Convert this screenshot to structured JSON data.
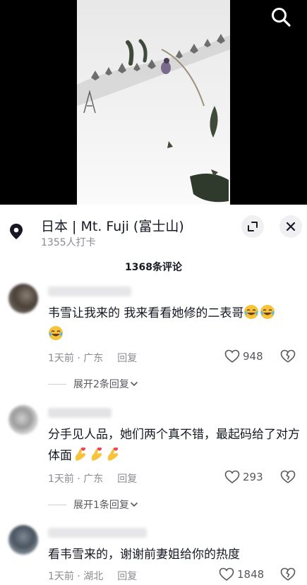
{
  "location": {
    "title": "日本 | Mt. Fuji (富士山)",
    "checkins": "1355人打卡"
  },
  "comment_count": "1368条评论",
  "comments": [
    {
      "text": "韦雪让我来的 我来看看她修的二表哥",
      "emojis": [
        "crying-laughing",
        "crying-laughing",
        "crying-laughing"
      ],
      "time_loc": "1天前 · 广东",
      "reply": "回复",
      "likes": "948",
      "expand": "展开2条回复"
    },
    {
      "text": "分手见人品，她们两个真不错，最起码给了对方体面",
      "emojis": [
        "finger-heart",
        "finger-heart",
        "finger-heart"
      ],
      "time_loc": "1天前 · 广东",
      "reply": "回复",
      "likes": "293",
      "expand": "展开1条回复"
    },
    {
      "text": "看韦雪来的，谢谢前妻姐给你的热度",
      "emojis": [],
      "time_loc": "1天前 · 湖北",
      "reply": "回复",
      "likes": "1848",
      "expand": ""
    }
  ],
  "colors": {
    "text_primary": "#161823",
    "text_secondary": "#8a8b91",
    "button_bg": "#f0f0f2"
  }
}
